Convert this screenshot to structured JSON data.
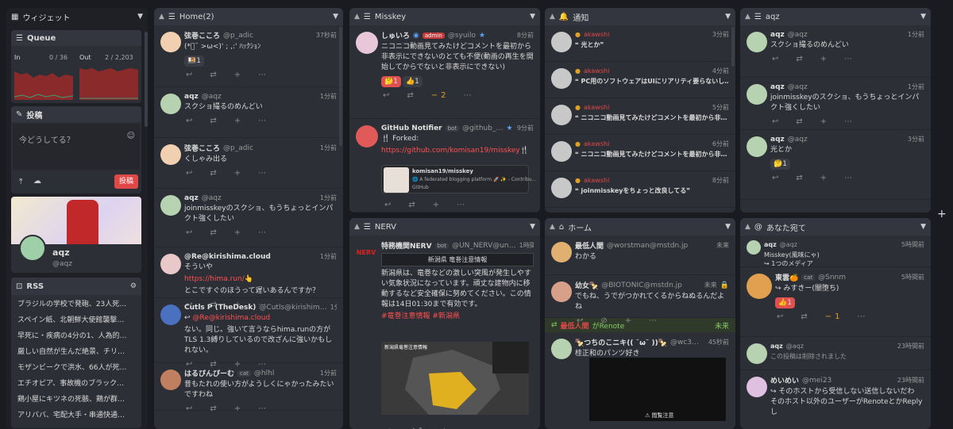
{
  "widgets": {
    "title": "ウィジェット",
    "queue": {
      "title": "Queue",
      "in_label": "In",
      "in_value": "0 / 36",
      "out_label": "Out",
      "out_value": "2 / 2,203"
    },
    "post": {
      "title": "投稿",
      "placeholder": "今どうしてる？",
      "submit": "投稿"
    },
    "profile": {
      "name": "aqz",
      "handle": "@aqz"
    },
    "rss": {
      "title": "RSS",
      "items": [
        "ブラジルの学校で発砲、23人死…",
        "スペイン紙、北朝鮮大使館襲撃…",
        "早死に・疾病の4分の1、人為的…",
        "厳しい自然が生んだ絶景、チリ…",
        "モザンビークで洪水、66人が死…",
        "エチオピア、事故機のブラック…",
        "鶏小屋にキツネの死骸、鶏が群…",
        "アリババ、宅配大手・串通快通…"
      ]
    }
  },
  "home": {
    "title": "Home(2)",
    "notes": [
      {
        "name": "弦巻こころ",
        "user": "@p_adic",
        "time": "37秒前",
        "text": "(*ﾟ˘ >ω<)' ;  ,:'  ﾊｯｸｼｮﾝ",
        "reaction": "🍱1"
      },
      {
        "name": "aqz",
        "user": "@aqz",
        "time": "1分前",
        "text": "スクショ撮るのめんどい"
      },
      {
        "name": "弦巻こころ",
        "user": "@p_adic",
        "time": "1分前",
        "text": "くしゃみ出る"
      },
      {
        "name": "aqz",
        "user": "@aqz",
        "time": "1分前",
        "text": "joinmisskeyのスクショ、もうちょっとインパクト強くしたい"
      },
      {
        "name": "@Re@kirishima.cloud",
        "user": "",
        "time": "1分前",
        "text": "そういや",
        "link": "https://hima.run/👆",
        "text2": "とこですぐのほうって遅いあるんですか？"
      },
      {
        "name": "Cutls P (TheDesk)",
        "user": "@Cutls@kirishim…",
        "time": "1分前",
        "reply": "@Re@kirishima.cloud",
        "text": "ない。同じ。強いて言うならhima.runの方がTLS 1.3縛りしているので改ざんに強いかもしれない。"
      },
      {
        "name": "はるぴんぴーむ",
        "user": "@hlhl",
        "time": "1分前",
        "badge": "cat",
        "text": "昔もたれの使い方がようしくにゃかったみたいですわね"
      }
    ]
  },
  "misskey": {
    "title": "Misskey",
    "notes": [
      {
        "name": "しゅいろ",
        "user": "@syuilo",
        "time": "8分前",
        "badge": "admin",
        "text": "ニコニコ動画見てみたけどコメントを最初から非表示にできないのとても不便(動画の再生を開始してからでないと非表示にできない)",
        "reactions": [
          "🤔1",
          "👍1"
        ],
        "renotes": "2"
      },
      {
        "name": "GitHub Notifier",
        "user": "@github_…",
        "time": "9分前",
        "badge": "bot",
        "text": "🍴 Forked:",
        "link": "https://github.com/komisan19/misskey🍴",
        "card_title": "komisan19/misskey",
        "card_desc": "🌐 A federated blogging platform 🚀 ✨ - Contribu…",
        "card_site": "GitHub"
      }
    ]
  },
  "nerv": {
    "title": "NERV",
    "note": {
      "name": "特務機関NERV",
      "user": "@UN_NERV@un…",
      "time": "1時間前",
      "badge": "bot",
      "box": "新潟県 竜巻注意情報",
      "text": "新潟県は、竜巻などの激しい突風が発生しやすい気象状況になっています。頑丈な建物内に移動するなど安全確保に努めてください。この情報は14日01:30まで有効です。",
      "tags": "#竜巻注意情報 #新潟県",
      "map_title": "新潟県竜巻注意情報",
      "renotes": "1"
    }
  },
  "notif": {
    "title": "通知",
    "items": [
      {
        "user": "akawshi",
        "time": "3分前",
        "text": "❝ 光とか❞"
      },
      {
        "user": "akawshi",
        "time": "4分前",
        "text": "❝ PC用のソフトウェアはUIにリアリティ要らないし…"
      },
      {
        "user": "akawshi",
        "time": "5分前",
        "text": "❝ ニコニコ動画見てみたけどコメントを最初から非…"
      },
      {
        "user": "akawshi",
        "time": "6分前",
        "text": "❝ ニコニコ動画見てみたけどコメントを最初から非…"
      },
      {
        "user": "akawshi",
        "time": "8分前",
        "text": "❝ joinmisskeyをちょっと改良してる❞"
      }
    ]
  },
  "hometl": {
    "title": "ホーム",
    "notes": [
      {
        "name": "最低人間",
        "user": "@worstman@mstdn.jp",
        "time": "未来",
        "text": "わかる"
      },
      {
        "name": "幼女🍢",
        "user": "@BIOTONIC@mstdn.jp",
        "time": "未来",
        "text": "でもね、うでがつかれてくるからねぬるんだよね"
      },
      {
        "renote_by": "最低人間",
        "renote_label": "がRenote",
        "time": "未来"
      },
      {
        "name": "🍢つちのこニキ((  ˘ω˘ ))🍢",
        "user": "@wc3…",
        "time": "45秒前",
        "text": "桂正和のパンツ好き",
        "media": "⚠ 閲覧注意"
      }
    ]
  },
  "aqz": {
    "title": "aqz",
    "notes": [
      {
        "name": "aqz",
        "user": "@aqz",
        "time": "1分前",
        "text": "スクショ撮るのめんどい"
      },
      {
        "name": "aqz",
        "user": "@aqz",
        "time": "1分前",
        "text": "joinmisskeyのスクショ、もうちょっとインパクト強くしたい"
      },
      {
        "name": "aqz",
        "user": "@aqz",
        "time": "3分前",
        "text": "光とか",
        "reaction": "🤔1"
      }
    ]
  },
  "mentions": {
    "title": "あなた宛て",
    "notes": [
      {
        "name": "aqz",
        "user": "@aqz",
        "time": "5時間前",
        "text": "Misskey(風味にゃ)",
        "text2": "↪ 1つのメディア"
      },
      {
        "name": "東雲🍊",
        "user": "@Snnm",
        "time": "5時間前",
        "badge": "cat",
        "text": "↪ みすきー(闇堕ち)",
        "reaction": "👍1",
        "renotes": "1"
      },
      {
        "name": "aqz",
        "user": "@aqz",
        "time": "23時間前",
        "text": "この投稿は削除されました"
      },
      {
        "name": "めいめい",
        "user": "@mei23",
        "time": "23時間前",
        "text": "↪ そのホストから受信しない送信しないだわ",
        "text2": "そのホスト以外のユーザーがRenoteとかReplyし"
      }
    ]
  }
}
